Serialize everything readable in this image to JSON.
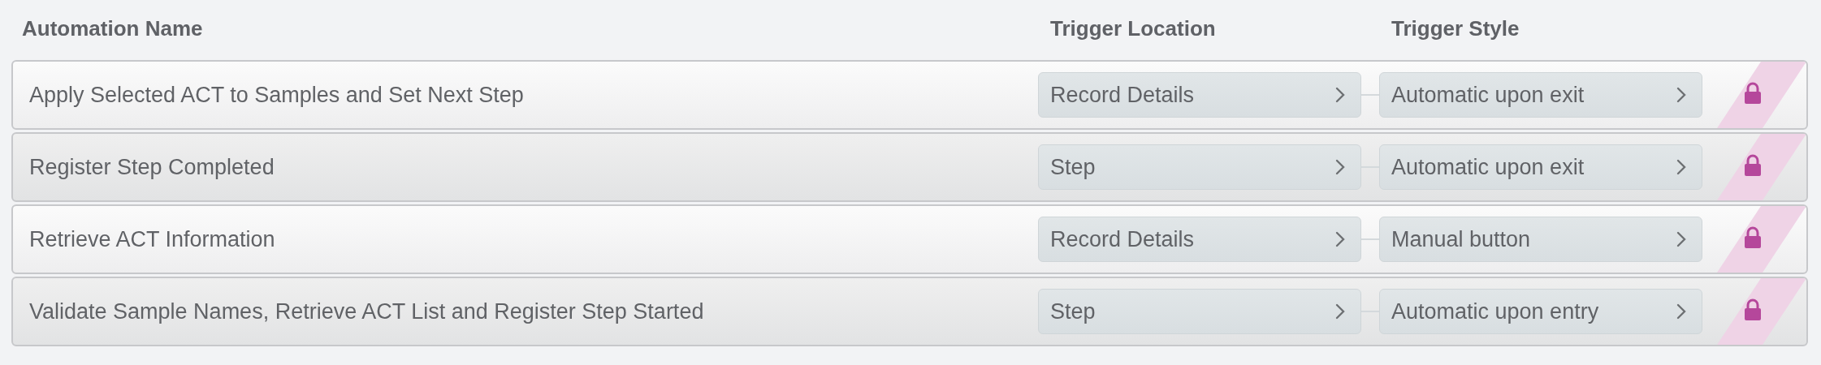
{
  "columns": [
    "Automation Name",
    "Trigger Location",
    "Trigger Style"
  ],
  "rows": [
    {
      "name": "Apply Selected ACT to Samples and Set Next Step",
      "location": "Record Details",
      "style": "Automatic upon exit",
      "locked": true
    },
    {
      "name": "Register Step Completed",
      "location": "Step",
      "style": "Automatic upon exit",
      "locked": true
    },
    {
      "name": "Retrieve ACT Information",
      "location": "Record Details",
      "style": "Manual button",
      "locked": true
    },
    {
      "name": "Validate Sample Names, Retrieve ACT List and Register Step Started",
      "location": "Step",
      "style": "Automatic upon entry",
      "locked": true
    }
  ]
}
